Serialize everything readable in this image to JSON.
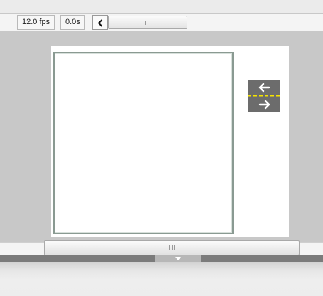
{
  "timeline": {
    "fps_label": "12.0 fps",
    "time_label": "0.0s"
  },
  "icons": {
    "scroll_left": "chevron-left-icon",
    "scroll_grip": "grip-icon",
    "symbol": "swap-arrows-icon",
    "collapse": "triangle-down-icon"
  },
  "colors": {
    "stage_bg": "#c8c8c8",
    "symbol_bg": "#6c6c6c",
    "symbol_dash": "#f5e300"
  }
}
